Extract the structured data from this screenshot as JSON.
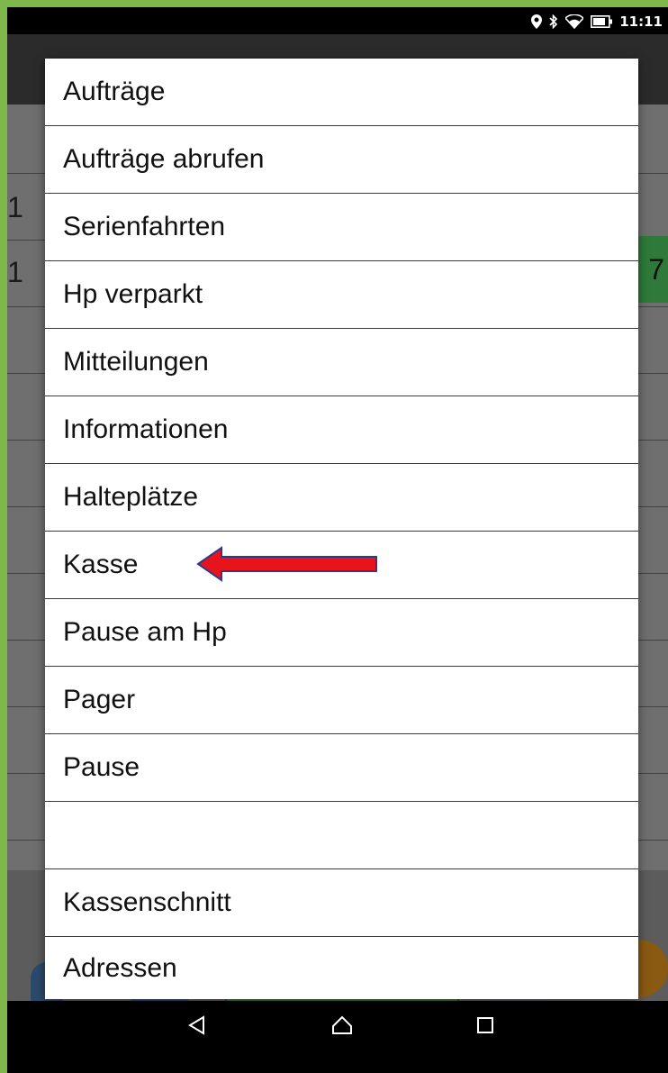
{
  "status_bar": {
    "time": "11:11",
    "icons": [
      "location-icon",
      "bluetooth-icon",
      "wifi-icon",
      "battery-icon"
    ]
  },
  "background": {
    "row_numbers": [
      "1",
      "1"
    ],
    "green_cell": "7"
  },
  "menu": {
    "items": [
      {
        "label": "Aufträge"
      },
      {
        "label": "Aufträge abrufen"
      },
      {
        "label": "Serienfahrten"
      },
      {
        "label": "Hp verparkt"
      },
      {
        "label": "Mitteilungen"
      },
      {
        "label": "Informationen"
      },
      {
        "label": "Halteplätze"
      },
      {
        "label": "Kasse",
        "highlighted_by_arrow": true
      },
      {
        "label": "Pause am Hp"
      },
      {
        "label": "Pager"
      },
      {
        "label": "Pause"
      },
      {
        "label": ""
      },
      {
        "label": "Kassenschnitt"
      },
      {
        "label": "Adressen"
      }
    ]
  },
  "annotation": {
    "arrow_color": "#e8141b",
    "arrow_outline": "#2a3a8c"
  },
  "nav_bar": {
    "buttons": [
      "back-icon",
      "home-icon",
      "recents-icon"
    ]
  },
  "colors": {
    "frame_border": "#7fb84a",
    "menu_bg": "#ffffff",
    "divider": "#3a3a3a"
  }
}
